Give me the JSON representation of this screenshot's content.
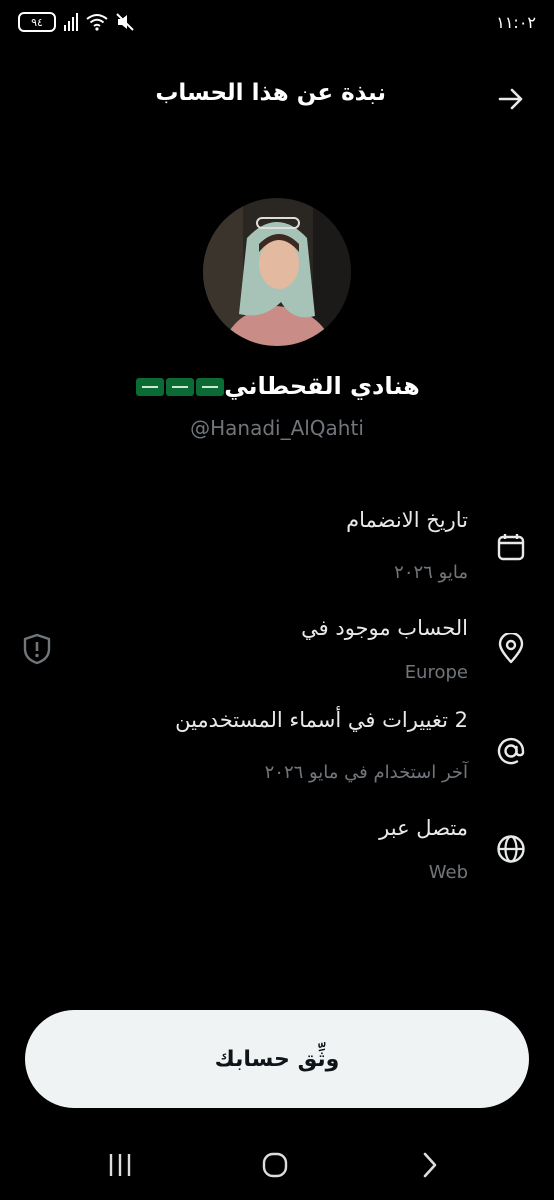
{
  "status_bar": {
    "time": "١١:٠٢",
    "battery": "٩٤"
  },
  "header": {
    "title": "نبذة عن هذا الحساب"
  },
  "profile": {
    "name": "هنادي القحطاني",
    "flag_icons": [
      "saudi-flag-icon",
      "saudi-flag-icon",
      "saudi-flag-icon"
    ],
    "handle": "@Hanadi_AlQahti"
  },
  "info": [
    {
      "icon": "calendar-icon",
      "title": "تاريخ الانضمام",
      "value": "مايو ٢٠٢٦"
    },
    {
      "icon": "location-pin-icon",
      "title": "الحساب موجود في",
      "value": "Europe"
    },
    {
      "icon": "at-sign-icon",
      "title": "2 تغييرات في أسماء المستخدمين",
      "value": "آخر استخدام في مايو ٢٠٢٦"
    },
    {
      "icon": "globe-icon",
      "title": "متصل عبر",
      "value": "Web"
    }
  ],
  "verify_button": {
    "label": "وثِّق حسابك"
  },
  "colors": {
    "background": "#000000",
    "primary_text": "#e7e9ea",
    "secondary_text": "#71767b",
    "button_bg": "#eff3f4",
    "button_text": "#0f1419"
  }
}
